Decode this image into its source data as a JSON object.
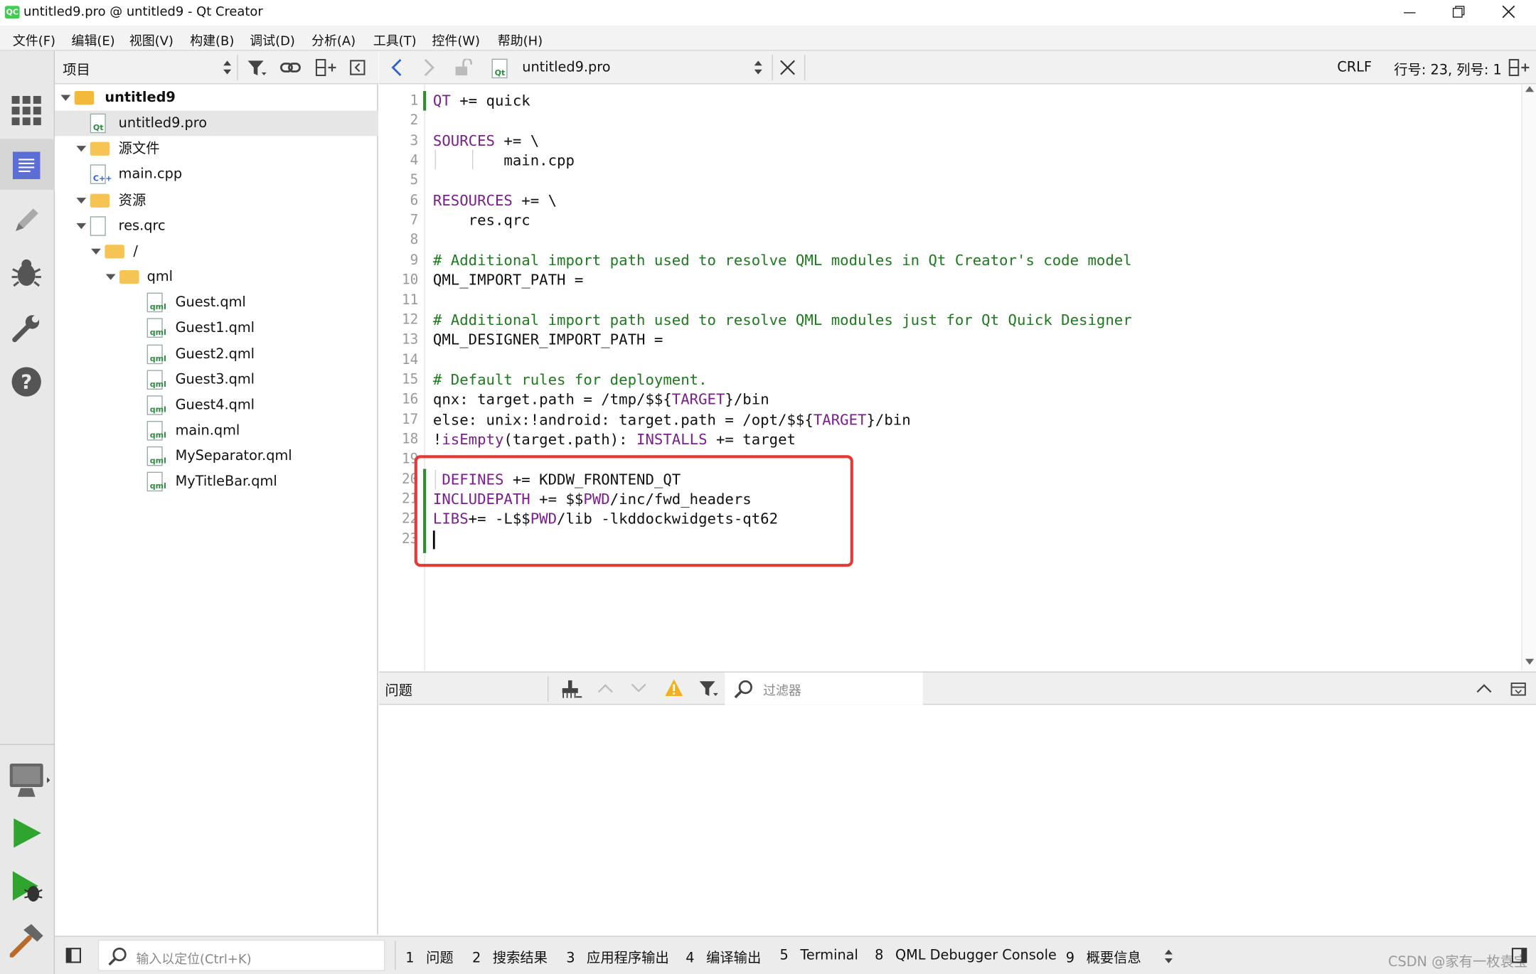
{
  "window": {
    "title": "untitled9.pro @ untitled9 - Qt Creator",
    "minimize_icon": "minimize-icon",
    "maximize_icon": "restore-icon",
    "close_icon": "close-icon"
  },
  "menu": [
    "文件(F)",
    "编辑(E)",
    "视图(V)",
    "构建(B)",
    "调试(D)",
    "分析(A)",
    "工具(T)",
    "控件(W)",
    "帮助(H)"
  ],
  "sidebar_modes": [
    "welcome-icon",
    "edit-icon",
    "design-icon",
    "debug-icon",
    "projects-icon",
    "help-icon",
    "target-selector-icon",
    "run-icon",
    "debug-run-icon",
    "build-icon"
  ],
  "project_panel": {
    "header_label": "项目",
    "tree": [
      {
        "label": "untitled9",
        "level": 0,
        "bold": true,
        "icon": "project-icon",
        "expanded": true
      },
      {
        "label": "untitled9.pro",
        "level": 1,
        "icon": "pro-file-icon",
        "selected": true
      },
      {
        "label": "源文件",
        "level": 1,
        "icon": "sources-folder-icon",
        "expanded": true
      },
      {
        "label": "main.cpp",
        "level": 2,
        "icon": "cpp-file-icon"
      },
      {
        "label": "资源",
        "level": 1,
        "icon": "resources-folder-icon",
        "expanded": true
      },
      {
        "label": "res.qrc",
        "level": 2,
        "icon": "qrc-file-icon",
        "expanded": true
      },
      {
        "label": "/",
        "level": 3,
        "icon": "folder-icon",
        "expanded": true
      },
      {
        "label": "qml",
        "level": 4,
        "icon": "folder-icon",
        "expanded": true
      },
      {
        "label": "Guest.qml",
        "level": 5,
        "icon": "qml-file-icon"
      },
      {
        "label": "Guest1.qml",
        "level": 5,
        "icon": "qml-file-icon"
      },
      {
        "label": "Guest2.qml",
        "level": 5,
        "icon": "qml-file-icon"
      },
      {
        "label": "Guest3.qml",
        "level": 5,
        "icon": "qml-file-icon"
      },
      {
        "label": "Guest4.qml",
        "level": 5,
        "icon": "qml-file-icon"
      },
      {
        "label": "main.qml",
        "level": 5,
        "icon": "qml-file-icon"
      },
      {
        "label": "MySeparator.qml",
        "level": 5,
        "icon": "qml-file-icon"
      },
      {
        "label": "MyTitleBar.qml",
        "level": 5,
        "icon": "qml-file-icon"
      }
    ]
  },
  "editor": {
    "file_name": "untitled9.pro",
    "line_ending": "CRLF",
    "cursor_pos": "行号: 23, 列号: 1",
    "lines": [
      [
        {
          "t": "QT",
          "c": "kw"
        },
        {
          "t": " += quick"
        }
      ],
      [],
      [
        {
          "t": "SOURCES",
          "c": "kw"
        },
        {
          "t": " += \\"
        }
      ],
      [
        {
          "t": "        main.cpp"
        }
      ],
      [],
      [
        {
          "t": "RESOURCES",
          "c": "kw"
        },
        {
          "t": " += \\"
        }
      ],
      [
        {
          "t": "    res.qrc"
        }
      ],
      [],
      [
        {
          "t": "# Additional import path used to resolve QML modules in Qt Creator's code model",
          "c": "cm"
        }
      ],
      [
        {
          "t": "QML_IMPORT_PATH ="
        }
      ],
      [],
      [
        {
          "t": "# Additional import path used to resolve QML modules just for Qt Quick Designer",
          "c": "cm"
        }
      ],
      [
        {
          "t": "QML_DESIGNER_IMPORT_PATH ="
        }
      ],
      [],
      [
        {
          "t": "# Default rules for deployment.",
          "c": "cm"
        }
      ],
      [
        {
          "t": "qnx: target.path = /tmp/$${"
        },
        {
          "t": "TARGET",
          "c": "kw"
        },
        {
          "t": "}/bin"
        }
      ],
      [
        {
          "t": "else: unix:!android: target.path = /opt/$${"
        },
        {
          "t": "TARGET",
          "c": "kw"
        },
        {
          "t": "}/bin"
        }
      ],
      [
        {
          "t": "!"
        },
        {
          "t": "isEmpty",
          "c": "kw"
        },
        {
          "t": "(target.path): "
        },
        {
          "t": "INSTALLS",
          "c": "kw"
        },
        {
          "t": " += target"
        }
      ],
      [],
      [
        {
          "t": " "
        },
        {
          "t": "DEFINES",
          "c": "kw"
        },
        {
          "t": " += KDDW_FRONTEND_QT"
        }
      ],
      [
        {
          "t": "INCLUDEPATH",
          "c": "kw"
        },
        {
          "t": " += $$"
        },
        {
          "t": "PWD",
          "c": "kw"
        },
        {
          "t": "/inc/fwd_headers"
        }
      ],
      [
        {
          "t": "LIBS",
          "c": "kw"
        },
        {
          "t": "+= -L$$"
        },
        {
          "t": "PWD",
          "c": "kw"
        },
        {
          "t": "/lib -lkddockwidgets-qt62"
        }
      ],
      []
    ]
  },
  "issues_panel": {
    "title": "问题",
    "filter_placeholder": "过滤器"
  },
  "statusbar": {
    "locator_placeholder": "输入以定位(Ctrl+K)",
    "tabs": [
      {
        "num": "1",
        "label": "问题"
      },
      {
        "num": "2",
        "label": "搜索结果"
      },
      {
        "num": "3",
        "label": "应用程序输出"
      },
      {
        "num": "4",
        "label": "编译输出"
      },
      {
        "num": "5",
        "label": "Terminal"
      },
      {
        "num": "8",
        "label": "QML Debugger Console"
      },
      {
        "num": "9",
        "label": "概要信息"
      }
    ],
    "watermark": "CSDN @家有一枚袁宝"
  },
  "colors": {
    "keyword": "#7a1e8c",
    "comment": "#1e7a1e",
    "highlight_box": "#e53935",
    "accent": "#2d62c8",
    "run_green": "#2fa52f"
  }
}
